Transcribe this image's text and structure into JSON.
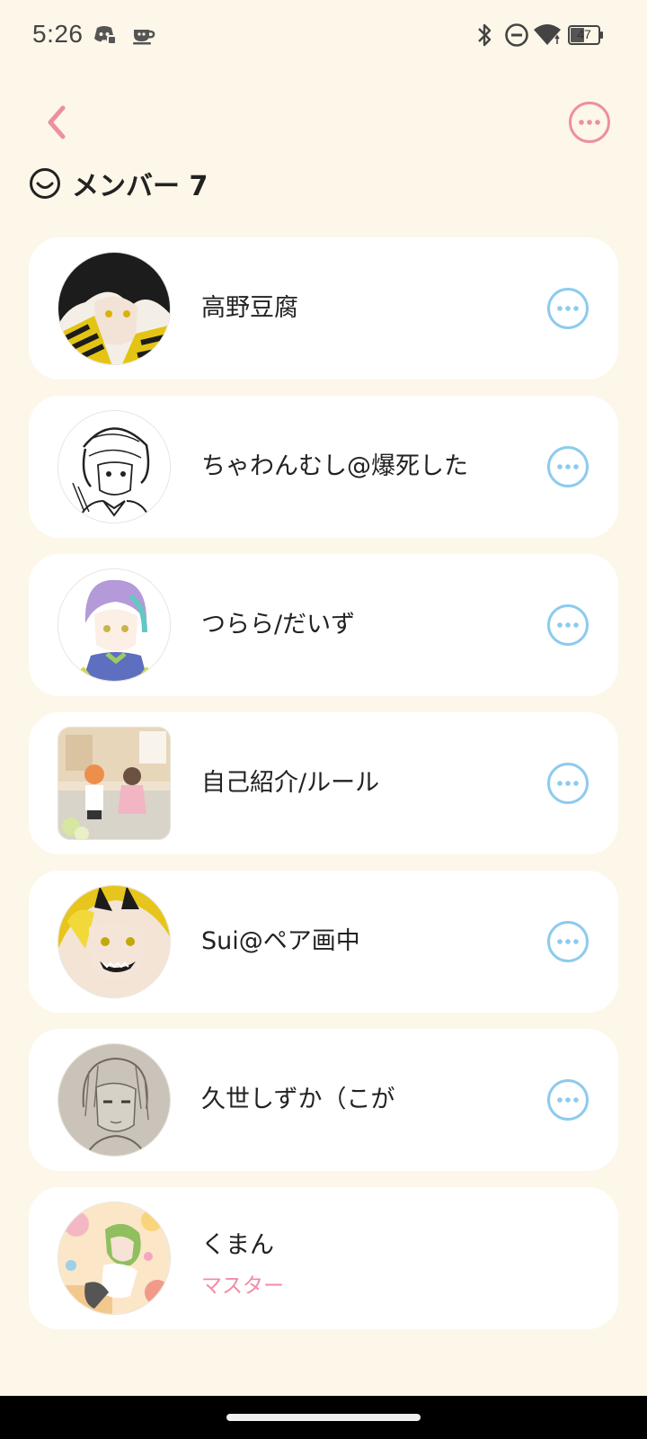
{
  "status_bar": {
    "time": "5:26",
    "battery": "47",
    "icons": [
      "discord-icon",
      "cup-icon",
      "bluetooth-icon",
      "do-not-disturb-icon",
      "wifi-icon",
      "battery-icon"
    ]
  },
  "header": {
    "back_icon": "chevron-left-icon",
    "more_icon": "more-horizontal-icon"
  },
  "section": {
    "title": "メンバー 7",
    "icon": "smile-icon"
  },
  "members": [
    {
      "name": "高野豆腐",
      "role": "",
      "has_menu": true
    },
    {
      "name": "ちゃわんむし@爆死した",
      "role": "",
      "has_menu": true
    },
    {
      "name": "つらら/だいず",
      "role": "",
      "has_menu": true
    },
    {
      "name": "自己紹介/ルール",
      "role": "",
      "has_menu": true
    },
    {
      "name": "Sui@ペア画中",
      "role": "",
      "has_menu": true
    },
    {
      "name": "久世しずか（こが",
      "role": "",
      "has_menu": true
    },
    {
      "name": "くまん",
      "role": "マスター",
      "has_menu": false
    }
  ],
  "colors": {
    "background": "#fcf7e9",
    "accent_pink": "#ee8ea2",
    "accent_blue": "#8ccbee",
    "role_pink": "#f08ca6"
  }
}
